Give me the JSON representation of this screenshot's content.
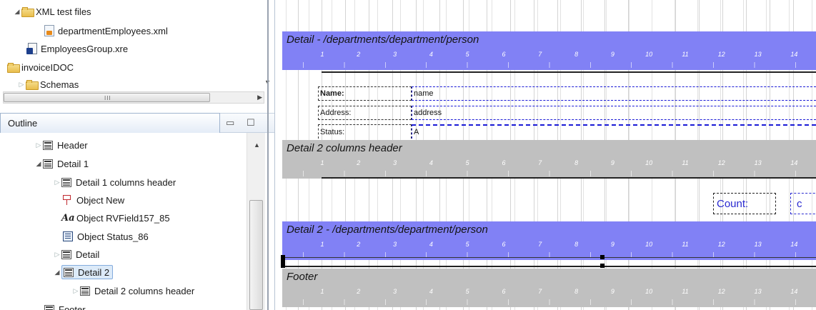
{
  "project_tree": {
    "items": [
      {
        "label": "XML test files",
        "icon": "folder-icon",
        "expanded": true
      },
      {
        "label": "departmentEmployees.xml",
        "icon": "xml-file-icon"
      },
      {
        "label": "EmployeesGroup.xre",
        "icon": "report-file-icon"
      },
      {
        "label": "invoiceIDOC",
        "icon": "project-icon"
      },
      {
        "label": "Schemas",
        "icon": "folder-icon",
        "expanded": false
      }
    ],
    "hscroll_grip": "III"
  },
  "outline": {
    "tab_label": "Outline",
    "minimize_glyph": "▭",
    "maximize_glyph": "☐",
    "items": [
      {
        "label": "Header",
        "icon": "band-icon",
        "indent": 1,
        "toggle": "closed"
      },
      {
        "label": "Detail 1",
        "icon": "band-icon",
        "indent": 1,
        "toggle": "open"
      },
      {
        "label": "Detail 1 columns header",
        "icon": "band-icon",
        "indent": 2,
        "toggle": "closed"
      },
      {
        "label": "Object New",
        "icon": "pin-icon",
        "indent": 2,
        "toggle": "none"
      },
      {
        "label": "Object RVField157_85",
        "icon": "text-field-icon",
        "indent": 2,
        "toggle": "none"
      },
      {
        "label": "Object Status_86",
        "icon": "status-field-icon",
        "indent": 2,
        "toggle": "none"
      },
      {
        "label": "Detail",
        "icon": "band-icon",
        "indent": 2,
        "toggle": "closed"
      },
      {
        "label": "Detail 2",
        "icon": "band-icon",
        "indent": 2,
        "toggle": "open",
        "selected": true
      },
      {
        "label": "Detail 2 columns header",
        "icon": "band-icon",
        "indent": 3,
        "toggle": "closed"
      },
      {
        "label": "Footer",
        "icon": "band-icon",
        "indent": 1,
        "toggle": "none"
      }
    ],
    "aa_glyph": "Aa"
  },
  "design": {
    "ruler_numbers": [
      "1",
      "2",
      "3",
      "4",
      "5",
      "6",
      "7",
      "8",
      "9",
      "10",
      "11",
      "12",
      "13",
      "14"
    ],
    "bands": [
      {
        "title": "Detail - /departments/department/person",
        "color": "#8181f5"
      },
      {
        "title": "Detail 2 columns header",
        "color": "#c0c0c0"
      },
      {
        "title": "Detail 2 - /departments/department/person",
        "color": "#8181f5"
      },
      {
        "title": "Footer",
        "color": "#c0c0c0"
      }
    ],
    "fields": [
      {
        "label": "Name:",
        "value": "name"
      },
      {
        "label": "Address:",
        "value": "address"
      },
      {
        "label": "Status:",
        "value": "A"
      }
    ],
    "count_label": "Count:",
    "c_label": "c"
  }
}
